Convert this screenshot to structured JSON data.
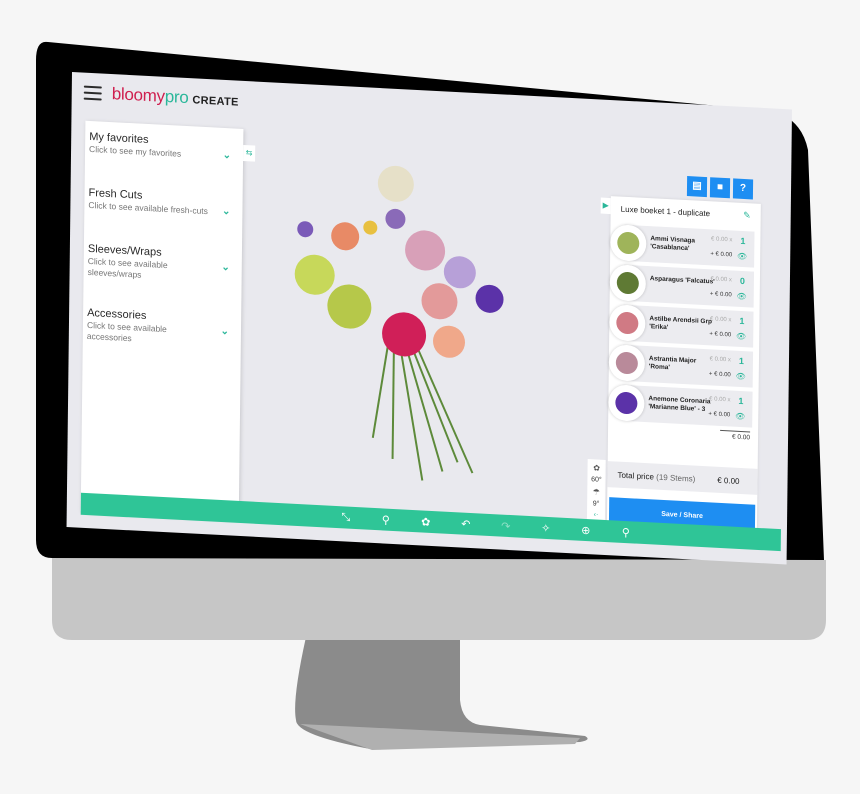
{
  "app": {
    "logo_part1": "bloomy",
    "logo_part2": "pro",
    "logo_part3": "CREATE",
    "brand_color": "#cf1f4f",
    "accent_color": "#2bb79a",
    "primary_color": "#1e8ef2"
  },
  "sidebar": {
    "items": [
      {
        "title": "My favorites",
        "subtitle": "Click to see my favorites"
      },
      {
        "title": "Fresh Cuts",
        "subtitle": "Click to see available fresh-cuts"
      },
      {
        "title": "Sleeves/Wraps",
        "subtitle": "Click to see available sleeves/wraps"
      },
      {
        "title": "Accessories",
        "subtitle": "Click to see available accessories"
      }
    ],
    "chevron_icon": "chevron-down-icon",
    "swap_icon": "swap-arrows-icon"
  },
  "toolbar": {
    "tools": [
      {
        "icon": "stem-path-icon",
        "glyph": "⤡"
      },
      {
        "icon": "stem-add-icon",
        "glyph": "⚲"
      },
      {
        "icon": "flower-select-icon",
        "glyph": "✿"
      },
      {
        "icon": "undo-icon",
        "glyph": "↶"
      },
      {
        "icon": "redo-icon",
        "glyph": "↷"
      },
      {
        "icon": "magic-wand-icon",
        "glyph": "✧"
      },
      {
        "icon": "crosshair-icon",
        "glyph": "⊕"
      },
      {
        "icon": "zoom-icon",
        "glyph": "⚲"
      }
    ]
  },
  "top_right_icons": [
    {
      "icon": "chat-icon",
      "glyph": "▤"
    },
    {
      "icon": "comments-icon",
      "glyph": "■"
    },
    {
      "icon": "help-icon",
      "glyph": "?"
    }
  ],
  "angles": {
    "angle1": "60°",
    "angle2": "9°",
    "collapse_glyph": "‹·"
  },
  "panel": {
    "title": "Luxe  boeket 1 - duplicate",
    "items": [
      {
        "name": "Ammi Visnaga 'Casablanca'",
        "unit_price": "€ 0.00  x",
        "qty": "1",
        "add_price": "+ € 0.00",
        "thumb_color": "#9fb45a"
      },
      {
        "name": "Asparagus 'Falcatus'",
        "unit_price": "€ 0.00  x",
        "qty": "0",
        "add_price": "+ € 0.00",
        "thumb_color": "#5f7a34"
      },
      {
        "name": "Astilbe Arendsii Grp 'Erika'",
        "unit_price": "€ 0.00  x",
        "qty": "1",
        "add_price": "+ € 0.00",
        "thumb_color": "#d07a84"
      },
      {
        "name": "Astrantia Major 'Roma'",
        "unit_price": "€ 0.00  x",
        "qty": "1",
        "add_price": "+ € 0.00",
        "thumb_color": "#b98a9a"
      },
      {
        "name": "Anemone Coronaria 'Marianne Blue' - 3",
        "unit_price": "€ 0.00  x",
        "qty": "1",
        "add_price": "+ € 0.00",
        "thumb_color": "#5b32a8"
      }
    ],
    "subtotal": "€ 0.00",
    "total_label": "Total price",
    "total_stems": "(19 Stems)",
    "total_value": "€ 0.00",
    "save_label": "Save / Share"
  }
}
